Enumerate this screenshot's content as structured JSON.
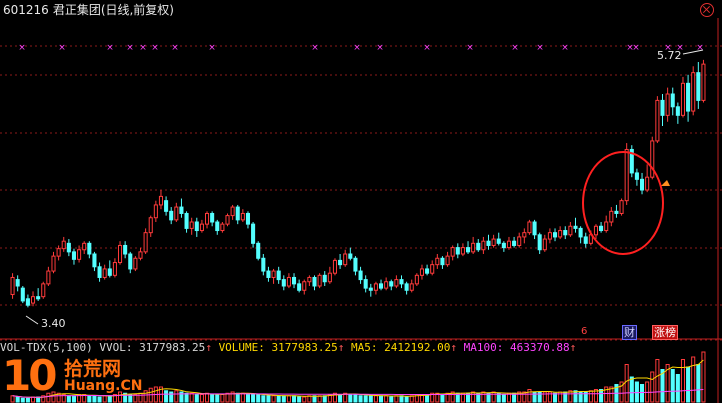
{
  "window": {
    "code": "601216",
    "name": "君正集团(日线,前复权)"
  },
  "price": {
    "high_label": "5.72",
    "low_label": "3.40"
  },
  "indicator_bar": {
    "name": "VOL-TDX(5,100)",
    "vvol_label": "VVOL: 3177983.25",
    "volume_label": "VOLUME: 3177983.25",
    "ma5_label": "MA5: 2412192.00",
    "ma100_label": "MA100: 463370.88",
    "arrow": "↑"
  },
  "tags": {
    "t6": "6",
    "t1": "财",
    "t2": "涨榜"
  },
  "watermark": {
    "num": "10",
    "cn": "拾荒网",
    "en": "Huang.CN"
  },
  "colors": {
    "bg": "#000000",
    "up": "#ff3b3b",
    "down": "#54ffff",
    "grid": "#8b1a1a",
    "marker": "#ff44ff",
    "circle": "#ff2020"
  },
  "chart_data": {
    "type": "candlestick",
    "period": "daily",
    "ylim": [
      3.3,
      5.85
    ],
    "annotations": [
      "5.72 (high)",
      "3.40 (low)"
    ],
    "candles": [
      [
        3.52,
        3.68,
        3.72,
        3.48
      ],
      [
        3.66,
        3.6,
        3.7,
        3.55
      ],
      [
        3.58,
        3.46,
        3.6,
        3.44
      ],
      [
        3.48,
        3.42,
        3.52,
        3.4
      ],
      [
        3.44,
        3.5,
        3.55,
        3.41
      ],
      [
        3.5,
        3.48,
        3.58,
        3.46
      ],
      [
        3.5,
        3.62,
        3.64,
        3.48
      ],
      [
        3.62,
        3.74,
        3.78,
        3.6
      ],
      [
        3.74,
        3.88,
        3.92,
        3.72
      ],
      [
        3.88,
        3.95,
        3.98,
        3.84
      ],
      [
        3.95,
        4.02,
        4.06,
        3.92
      ],
      [
        4.0,
        3.92,
        4.04,
        3.88
      ],
      [
        3.92,
        3.85,
        3.95,
        3.8
      ],
      [
        3.85,
        3.94,
        3.98,
        3.82
      ],
      [
        3.94,
        4.0,
        4.02,
        3.9
      ],
      [
        4.0,
        3.9,
        4.02,
        3.86
      ],
      [
        3.9,
        3.78,
        3.92,
        3.74
      ],
      [
        3.78,
        3.68,
        3.82,
        3.64
      ],
      [
        3.68,
        3.76,
        3.8,
        3.66
      ],
      [
        3.76,
        3.7,
        3.84,
        3.68
      ],
      [
        3.7,
        3.82,
        3.86,
        3.68
      ],
      [
        3.82,
        3.98,
        4.02,
        3.8
      ],
      [
        3.98,
        3.9,
        4.02,
        3.86
      ],
      [
        3.9,
        3.76,
        3.92,
        3.72
      ],
      [
        3.76,
        3.86,
        3.88,
        3.74
      ],
      [
        3.86,
        3.92,
        3.96,
        3.84
      ],
      [
        3.92,
        4.1,
        4.14,
        3.9
      ],
      [
        4.1,
        4.24,
        4.26,
        4.06
      ],
      [
        4.24,
        4.36,
        4.4,
        4.2
      ],
      [
        4.36,
        4.44,
        4.5,
        4.32
      ],
      [
        4.4,
        4.3,
        4.44,
        4.26
      ],
      [
        4.3,
        4.22,
        4.34,
        4.18
      ],
      [
        4.22,
        4.34,
        4.38,
        4.2
      ],
      [
        4.34,
        4.28,
        4.42,
        4.24
      ],
      [
        4.28,
        4.14,
        4.3,
        4.1
      ],
      [
        4.14,
        4.2,
        4.24,
        4.08
      ],
      [
        4.2,
        4.12,
        4.24,
        4.06
      ],
      [
        4.12,
        4.18,
        4.22,
        4.1
      ],
      [
        4.18,
        4.28,
        4.3,
        4.14
      ],
      [
        4.28,
        4.2,
        4.3,
        4.16
      ],
      [
        4.2,
        4.12,
        4.22,
        4.08
      ],
      [
        4.12,
        4.18,
        4.2,
        4.1
      ],
      [
        4.18,
        4.26,
        4.28,
        4.16
      ],
      [
        4.26,
        4.34,
        4.36,
        4.22
      ],
      [
        4.34,
        4.22,
        4.36,
        4.18
      ],
      [
        4.22,
        4.28,
        4.32,
        4.2
      ],
      [
        4.28,
        4.18,
        4.3,
        4.14
      ],
      [
        4.18,
        4.0,
        4.2,
        3.96
      ],
      [
        4.0,
        3.86,
        4.02,
        3.84
      ],
      [
        3.86,
        3.74,
        3.9,
        3.7
      ],
      [
        3.74,
        3.68,
        3.78,
        3.64
      ],
      [
        3.68,
        3.74,
        3.76,
        3.62
      ],
      [
        3.74,
        3.66,
        3.78,
        3.62
      ],
      [
        3.66,
        3.6,
        3.7,
        3.56
      ],
      [
        3.6,
        3.68,
        3.72,
        3.58
      ],
      [
        3.68,
        3.62,
        3.72,
        3.58
      ],
      [
        3.62,
        3.56,
        3.66,
        3.54
      ],
      [
        3.56,
        3.64,
        3.66,
        3.52
      ],
      [
        3.64,
        3.68,
        3.7,
        3.6
      ],
      [
        3.68,
        3.6,
        3.7,
        3.56
      ],
      [
        3.6,
        3.7,
        3.72,
        3.58
      ],
      [
        3.7,
        3.64,
        3.74,
        3.6
      ],
      [
        3.64,
        3.72,
        3.78,
        3.62
      ],
      [
        3.72,
        3.84,
        3.86,
        3.7
      ],
      [
        3.84,
        3.8,
        3.9,
        3.76
      ],
      [
        3.8,
        3.9,
        3.94,
        3.78
      ],
      [
        3.9,
        3.86,
        3.96,
        3.84
      ],
      [
        3.86,
        3.74,
        3.88,
        3.7
      ],
      [
        3.74,
        3.66,
        3.78,
        3.62
      ],
      [
        3.66,
        3.58,
        3.7,
        3.54
      ],
      [
        3.58,
        3.56,
        3.62,
        3.5
      ],
      [
        3.56,
        3.62,
        3.64,
        3.52
      ],
      [
        3.62,
        3.58,
        3.66,
        3.56
      ],
      [
        3.58,
        3.64,
        3.68,
        3.56
      ],
      [
        3.64,
        3.6,
        3.66,
        3.56
      ],
      [
        3.6,
        3.66,
        3.7,
        3.58
      ],
      [
        3.66,
        3.62,
        3.7,
        3.58
      ],
      [
        3.62,
        3.56,
        3.64,
        3.52
      ],
      [
        3.56,
        3.62,
        3.66,
        3.54
      ],
      [
        3.62,
        3.7,
        3.72,
        3.6
      ],
      [
        3.7,
        3.76,
        3.8,
        3.66
      ],
      [
        3.76,
        3.72,
        3.8,
        3.7
      ],
      [
        3.72,
        3.8,
        3.84,
        3.7
      ],
      [
        3.8,
        3.86,
        3.9,
        3.76
      ],
      [
        3.86,
        3.8,
        3.88,
        3.76
      ],
      [
        3.8,
        3.88,
        3.92,
        3.78
      ],
      [
        3.88,
        3.96,
        3.98,
        3.84
      ],
      [
        3.96,
        3.9,
        4.0,
        3.86
      ],
      [
        3.9,
        3.96,
        4.0,
        3.88
      ],
      [
        3.96,
        3.92,
        4.02,
        3.9
      ],
      [
        3.92,
        4.0,
        4.06,
        3.9
      ],
      [
        4.0,
        3.94,
        4.04,
        3.92
      ],
      [
        3.94,
        4.02,
        4.06,
        3.9
      ],
      [
        4.02,
        3.98,
        4.08,
        3.94
      ],
      [
        3.98,
        4.04,
        4.08,
        3.96
      ],
      [
        4.04,
        4.0,
        4.1,
        3.98
      ],
      [
        4.0,
        3.96,
        4.02,
        3.92
      ],
      [
        3.96,
        4.02,
        4.06,
        3.94
      ],
      [
        4.02,
        3.98,
        4.06,
        3.96
      ],
      [
        3.98,
        4.06,
        4.1,
        3.96
      ],
      [
        4.06,
        4.1,
        4.14,
        4.0
      ],
      [
        4.1,
        4.2,
        4.22,
        4.08
      ],
      [
        4.2,
        4.08,
        4.22,
        4.04
      ],
      [
        4.08,
        3.94,
        4.1,
        3.9
      ],
      [
        3.94,
        4.04,
        4.08,
        3.92
      ],
      [
        4.04,
        4.1,
        4.14,
        4.0
      ],
      [
        4.1,
        4.06,
        4.14,
        4.02
      ],
      [
        4.06,
        4.12,
        4.16,
        4.04
      ],
      [
        4.12,
        4.08,
        4.16,
        4.04
      ],
      [
        4.08,
        4.16,
        4.2,
        4.06
      ],
      [
        4.16,
        4.14,
        4.24,
        4.1
      ],
      [
        4.14,
        4.06,
        4.16,
        4.0
      ],
      [
        4.06,
        4.0,
        4.1,
        3.96
      ],
      [
        4.0,
        4.08,
        4.12,
        3.98
      ],
      [
        4.08,
        4.16,
        4.18,
        4.04
      ],
      [
        4.16,
        4.12,
        4.2,
        4.1
      ],
      [
        4.12,
        4.2,
        4.26,
        4.1
      ],
      [
        4.2,
        4.3,
        4.34,
        4.16
      ],
      [
        4.3,
        4.28,
        4.36,
        4.24
      ],
      [
        4.28,
        4.4,
        4.42,
        4.26
      ],
      [
        4.4,
        4.88,
        4.94,
        4.36
      ],
      [
        4.88,
        4.66,
        4.92,
        4.62
      ],
      [
        4.66,
        4.6,
        4.7,
        4.54
      ],
      [
        4.6,
        4.5,
        4.66,
        4.46
      ],
      [
        4.5,
        4.62,
        4.74,
        4.48
      ],
      [
        4.62,
        4.96,
        5.0,
        4.6
      ],
      [
        4.96,
        5.34,
        5.38,
        4.94
      ],
      [
        5.34,
        5.2,
        5.4,
        5.1
      ],
      [
        5.2,
        5.4,
        5.46,
        5.14
      ],
      [
        5.4,
        5.28,
        5.46,
        5.2
      ],
      [
        5.28,
        5.2,
        5.32,
        5.12
      ],
      [
        5.2,
        5.5,
        5.56,
        5.18
      ],
      [
        5.5,
        5.24,
        5.58,
        5.14
      ],
      [
        5.24,
        5.6,
        5.66,
        5.2
      ],
      [
        5.6,
        5.34,
        5.7,
        5.26
      ],
      [
        5.34,
        5.68,
        5.72,
        5.32
      ]
    ],
    "volume": [
      5,
      4,
      3,
      3,
      4,
      4,
      5,
      7,
      8,
      7,
      6,
      5,
      5,
      6,
      6,
      5,
      5,
      4,
      5,
      5,
      6,
      8,
      7,
      6,
      6,
      7,
      9,
      11,
      12,
      12,
      9,
      8,
      9,
      8,
      7,
      7,
      6,
      6,
      7,
      6,
      6,
      6,
      7,
      8,
      7,
      7,
      6,
      6,
      6,
      5,
      5,
      5,
      5,
      5,
      5,
      5,
      4,
      4,
      5,
      5,
      5,
      5,
      6,
      7,
      6,
      7,
      6,
      6,
      5,
      5,
      5,
      5,
      5,
      5,
      4,
      5,
      5,
      4,
      5,
      6,
      6,
      6,
      7,
      7,
      6,
      7,
      8,
      7,
      7,
      7,
      8,
      7,
      8,
      7,
      8,
      7,
      6,
      7,
      7,
      8,
      8,
      10,
      8,
      8,
      8,
      8,
      7,
      8,
      8,
      9,
      9,
      8,
      8,
      9,
      10,
      10,
      12,
      12,
      14,
      16,
      30,
      20,
      16,
      14,
      16,
      24,
      34,
      26,
      30,
      26,
      22,
      34,
      28,
      36,
      30,
      40
    ]
  }
}
